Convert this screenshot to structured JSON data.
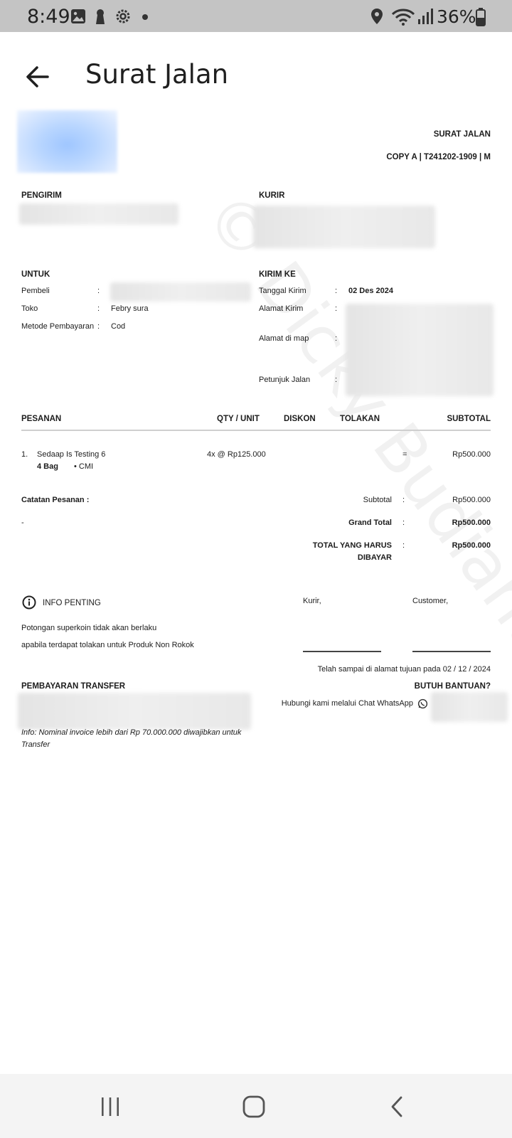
{
  "status_bar": {
    "time": "8:49",
    "battery_percent": "36%",
    "left_icons": [
      "gallery-icon",
      "keyhole-icon",
      "settings-gear-icon",
      "notification-dot-icon"
    ],
    "right_icons": [
      "location-pin-icon",
      "wifi-icon",
      "signal-icon",
      "battery-icon"
    ]
  },
  "header": {
    "title": "Surat Jalan",
    "back_icon": "arrow-left-icon"
  },
  "document": {
    "doc_title": "SURAT JALAN",
    "copy_line": "COPY A | T241202-1909 | M",
    "sender_label": "PENGIRIM",
    "courier_label": "KURIR",
    "for_section": {
      "label": "UNTUK",
      "rows": [
        {
          "label": "Pembeli",
          "sep": ":",
          "value": ""
        },
        {
          "label": "Toko",
          "sep": ":",
          "value": "Febry sura"
        },
        {
          "label": "Metode Pembayaran",
          "sep": ":",
          "value": "Cod"
        }
      ]
    },
    "ship_section": {
      "label": "KIRIM KE",
      "rows": [
        {
          "label": "Tanggal Kirim",
          "sep": ":",
          "value": "02 Des 2024"
        },
        {
          "label": "Alamat Kirim",
          "sep": ":",
          "value": ""
        },
        {
          "label": "Alamat di map",
          "sep": ":",
          "value": ""
        },
        {
          "label": "Petunjuk Jalan",
          "sep": ":",
          "value": ""
        }
      ]
    },
    "table": {
      "headers": {
        "pesanan": "PESANAN",
        "qty": "QTY / UNIT",
        "diskon": "DISKON",
        "tolakan": "TOLAKAN",
        "subtotal": "SUBTOTAL"
      },
      "items": [
        {
          "no": "1.",
          "name": "Sedaap Is Testing 6",
          "unit": "4 Bag",
          "brand": "• CMI",
          "qty": "4x  @ Rp125.000",
          "eq": "=",
          "subtotal": "Rp500.000"
        }
      ]
    },
    "notes": {
      "label": "Catatan Pesanan :",
      "value": "-"
    },
    "totals": [
      {
        "label": "Subtotal",
        "sep": ":",
        "value": "Rp500.000"
      },
      {
        "label": "Grand Total",
        "sep": ":",
        "value": "Rp500.000"
      },
      {
        "label": "TOTAL YANG HARUS",
        "label2": "DIBAYAR",
        "sep": ":",
        "value": "Rp500.000"
      }
    ],
    "info": {
      "title": "INFO PENTING",
      "line1": "Potongan superkoin tidak akan berlaku",
      "line2": "apabila terdapat tolakan untuk Produk Non Rokok"
    },
    "signatures": {
      "courier": "Kurir,",
      "customer": "Customer,",
      "arrival": "Telah sampai di alamat tujuan pada 02 / 12 / 2024"
    },
    "transfer": {
      "label": "PEMBAYARAN TRANSFER",
      "note1": "Info: Nominal invoice lebih dari Rp 70.000.000 diwajibkan untuk",
      "note2": "Transfer"
    },
    "help": {
      "label": "BUTUH BANTUAN?",
      "text": "Hubungi kami melalui Chat WhatsApp"
    },
    "watermark": "© Dicky Budianto Sugiono"
  },
  "nav": {
    "recents": "recent-apps-icon",
    "home": "home-icon",
    "back": "back-chevron-icon"
  }
}
